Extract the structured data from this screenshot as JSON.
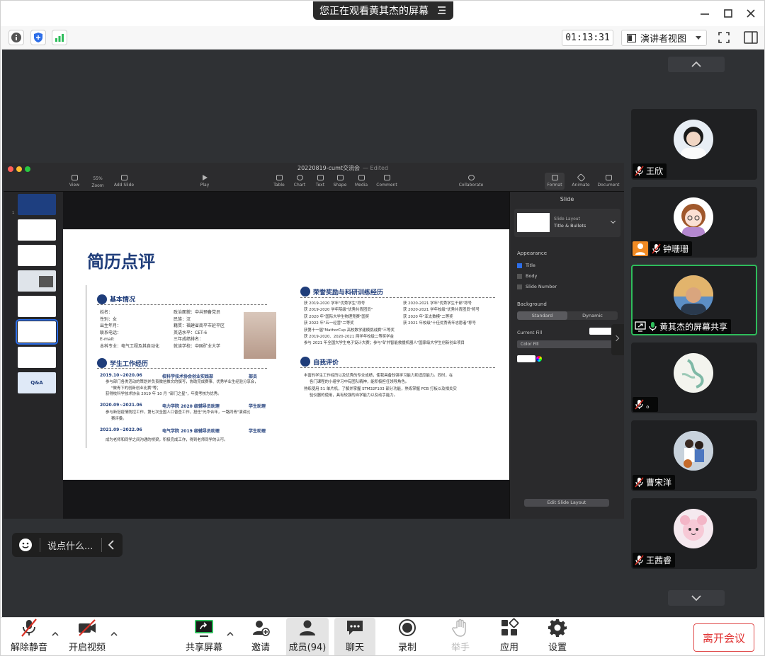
{
  "titlebar": {
    "share_notice": "您正在观看黄其杰的屏幕"
  },
  "toolbar2": {
    "timer": "01:13:31",
    "view_mode": "演讲者视图"
  },
  "keynote": {
    "doc_title": "20220819-cumt交流会",
    "edited": "— Edited",
    "tools": [
      {
        "label": "View"
      },
      {
        "label": "Zoom"
      },
      {
        "label": "Add Slide"
      },
      {
        "label": "Play"
      },
      {
        "label": "Table"
      },
      {
        "label": "Chart"
      },
      {
        "label": "Text"
      },
      {
        "label": "Shape"
      },
      {
        "label": "Media"
      },
      {
        "label": "Comment"
      },
      {
        "label": "Collaborate"
      },
      {
        "label": "Format"
      },
      {
        "label": "Animate"
      },
      {
        "label": "Document"
      }
    ],
    "zoom_value": "55%",
    "thumb_labels": [
      "Q&A"
    ],
    "right_panel": {
      "header": "Slide",
      "layout_caption": "Slide Layout",
      "layout_name": "Title & Bullets",
      "appearance": "Appearance",
      "check_title": "Title",
      "check_body": "Body",
      "check_slide_number": "Slide Number",
      "background": "Background",
      "seg_standard": "Standard",
      "seg_dynamic": "Dynamic",
      "current_fill": "Current Fill",
      "color_fill": "Color Fill",
      "edit_layout": "Edit Slide Layout"
    }
  },
  "slide": {
    "title": "简历点评",
    "sec1": "基本情况",
    "sec2": "学生工作经历",
    "sec3": "荣誉奖励与科研训练经历",
    "sec4": "自我评价",
    "basic_left": [
      "姓名：",
      "性别：女",
      "出生年月：",
      "联系电话：",
      "E-mail:",
      "本科专业：电气工程及其自动化"
    ],
    "basic_right": [
      "政治面貌：中共预备党员",
      "民族：汉",
      "籍贯：福建省南平市延平区",
      "英语水平：CET-6",
      "三年成绩排名：",
      "就读学校：中国矿业大学"
    ],
    "work": [
      {
        "period": "2019.10~2020.06",
        "org": "校科学技术协会创业实践部",
        "role": "部员"
      },
      {
        "period": "2020.09~2021.06",
        "org": "电力学院 2020 级辅导员助理",
        "role": "学生助理"
      },
      {
        "period": "2021.09~2022.06",
        "org": "电气学院 2019 级辅导员助理",
        "role": "学生助理"
      }
    ],
    "work_details": [
      "参与部门各类活动的策划并负责微信推文的撰写，协助完成赛事、优秀毕业生经验分享会，",
      "\"做青下的创新创业比赛\"等；",
      "获得校科学技术协会 2019 年 10 月 \"部门之星\"，年度考核为优秀。",
      "参与新冠疫情防控工作，第七次全国人口普查工作，担任\"光华合年，一路同青\"演讲比",
      "赛评委。",
      "成为老师和同学之间沟通的桥梁，积极完成工作，得到老师同学的认可。"
    ],
    "honors_left": [
      "获 2019-2020 学年\"优秀学生\"称号",
      "获 2019-2020 学年院级\"优秀共青团员\"",
      "获 2020 年\"国际大学生物理竞赛\"国奖",
      "获 2022 年\"五一经营\"二等奖",
      "获第十一届\"MathorCup 高校数学建模挑战赛\"三等奖",
      "获 2019-2020、2020-2021 两学年校级二等奖学金",
      "参与 2021 年全国大学生电子设计大赛；参与\"矿井智能救援机器人\"国家级大学生创新创业项目"
    ],
    "honors_right": [
      "获 2020-2021 学年\"优秀学生干部\"称号",
      "获 2020-2021 学年校级\"优秀共青团员\"称号",
      "获 2020 年\"亚太数模\"二等奖",
      "获 2021 年校级\"十佳优秀青年志愿者\"称号"
    ],
    "self_eval": [
      "丰富的学生工作经历以及优秀的专业成绩，使我具备较强学习能力和适应能力。同时，在",
      "各门课程的小组学习中有团队精神，能积极担任领导角色。",
      "熟练使用 51 单片机，了解并掌握 STM32F103 部分功能，熟练掌握 PCB 打板以及相关实",
      "验仪器的使用，具有较强的自学能力以及动手能力。"
    ]
  },
  "chat": {
    "placeholder": "说点什么..."
  },
  "gallery": {
    "participants": [
      {
        "name": "王欣",
        "muted": true
      },
      {
        "name": "钟珊珊",
        "muted": true
      },
      {
        "name": "黄其杰的屏幕共享",
        "muted": false,
        "active": true
      },
      {
        "name": "。",
        "muted": true
      },
      {
        "name": "曹宋洋",
        "muted": true
      },
      {
        "name": "王茜睿",
        "muted": true
      }
    ]
  },
  "bottombar": {
    "unmute": "解除静音",
    "start_video": "开启视频",
    "share_screen": "共享屏幕",
    "invite": "邀请",
    "members": "成员(94)",
    "chat": "聊天",
    "record": "录制",
    "raise_hand": "举手",
    "apps": "应用",
    "settings": "设置",
    "leave": "离开会议"
  },
  "colors": {
    "accent_green": "#2ebd5b",
    "leave_red": "#e03030",
    "slide_blue": "#1f3d7a",
    "mute_red": "#d93025"
  }
}
